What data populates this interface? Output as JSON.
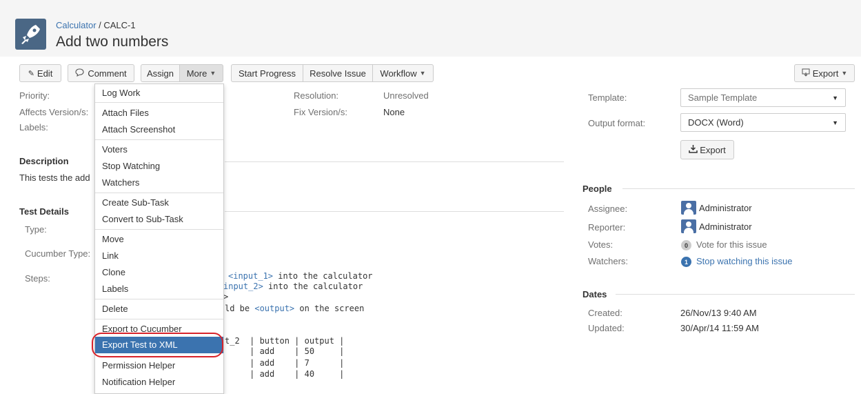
{
  "header": {
    "project": "Calculator",
    "separator": " / ",
    "issue_key": "CALC-1",
    "title": "Add two numbers"
  },
  "toolbar": {
    "edit": "Edit",
    "comment": "Comment",
    "assign": "Assign",
    "more": "More",
    "start_progress": "Start Progress",
    "resolve_issue": "Resolve Issue",
    "workflow": "Workflow",
    "export": "Export"
  },
  "details": {
    "priority_label": "Priority:",
    "affects_label": "Affects Version/s:",
    "labels_label": "Labels:",
    "resolution_label": "Resolution:",
    "resolution_value": "Unresolved",
    "fix_label": "Fix Version/s:",
    "fix_value": "None"
  },
  "description": {
    "heading": "Description",
    "text": "This tests the add"
  },
  "test_details": {
    "heading": "Test Details",
    "type_label": "Type:",
    "cucumber_label": "Cucumber Type:",
    "steps_label": "Steps:",
    "step1_var": "<input_1>",
    "step1_rest": " into the calculator",
    "step2_var": "input_2>",
    "step2_rest": " into the calculator",
    "step3": ">",
    "step4_pre": "ld be ",
    "step4_var": "<output>",
    "step4_rest": " on the screen",
    "table_row0": "t_2  | button | output |",
    "table_row1": "     | add    | 50     |",
    "table_row2": "     | add    | 7      |",
    "table_row3": "     | add    | 40     |"
  },
  "export_panel": {
    "template_label": "Template:",
    "template_value": "Sample Template",
    "format_label": "Output format:",
    "format_value": "DOCX (Word)",
    "export_button": "Export"
  },
  "people": {
    "heading": "People",
    "assignee_label": "Assignee:",
    "assignee": "Administrator",
    "reporter_label": "Reporter:",
    "reporter": "Administrator",
    "votes_label": "Votes:",
    "votes_count": "0",
    "votes_link": "Vote for this issue",
    "watchers_label": "Watchers:",
    "watchers_count": "1",
    "watchers_link": "Stop watching this issue"
  },
  "dates": {
    "heading": "Dates",
    "created_label": "Created:",
    "created": "26/Nov/13 9:40 AM",
    "updated_label": "Updated:",
    "updated": "30/Apr/14 11:59 AM"
  },
  "more_menu": [
    "Log Work",
    "Attach Files",
    "Attach Screenshot",
    "Voters",
    "Stop Watching",
    "Watchers",
    "Create Sub-Task",
    "Convert to Sub-Task",
    "Move",
    "Link",
    "Clone",
    "Labels",
    "Delete",
    "Export to Cucumber",
    "Export Test to XML",
    "Permission Helper",
    "Notification Helper"
  ],
  "colors": {
    "link": "#3b73af",
    "highlight": "#3b73af",
    "annotation": "#d8232a"
  }
}
